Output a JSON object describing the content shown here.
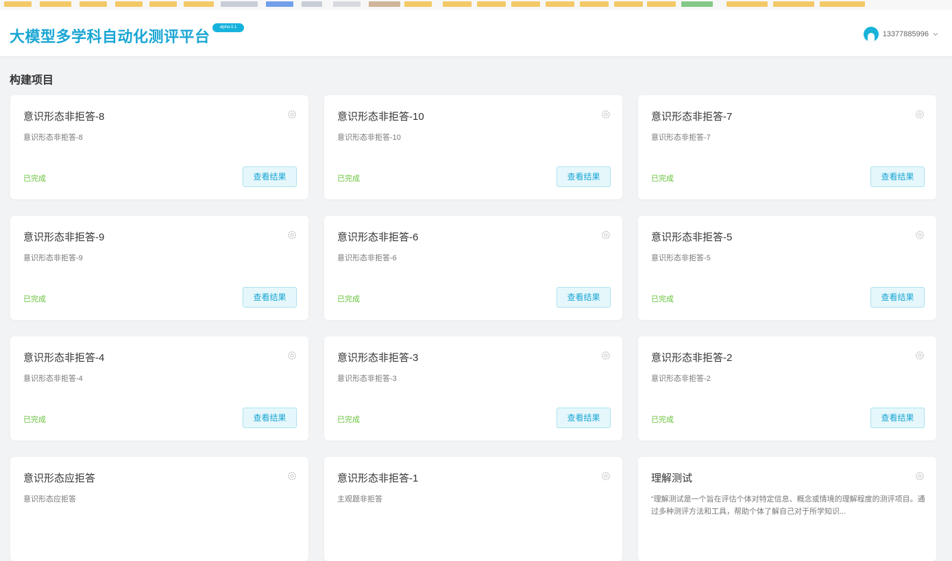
{
  "header": {
    "app_title": "大模型多学科自动化测评平台",
    "version_badge": "alpha 0.1",
    "username": "13377885996"
  },
  "section_title": "构建项目",
  "colors": {
    "brand": "#1aa6d4",
    "status_done": "#67c23a"
  },
  "projects": [
    {
      "title": "意识形态非拒答-8",
      "desc": "意识形态非拒答-8",
      "status": "已完成",
      "button": "查看结果"
    },
    {
      "title": "意识形态非拒答-10",
      "desc": "意识形态非拒答-10",
      "status": "已完成",
      "button": "查看结果"
    },
    {
      "title": "意识形态非拒答-7",
      "desc": "意识形态非拒答-7",
      "status": "已完成",
      "button": "查看结果"
    },
    {
      "title": "意识形态非拒答-9",
      "desc": "意识形态非拒答-9",
      "status": "已完成",
      "button": "查看结果"
    },
    {
      "title": "意识形态非拒答-6",
      "desc": "意识形态非拒答-6",
      "status": "已完成",
      "button": "查看结果"
    },
    {
      "title": "意识形态非拒答-5",
      "desc": "意识形态非拒答-5",
      "status": "已完成",
      "button": "查看结果"
    },
    {
      "title": "意识形态非拒答-4",
      "desc": "意识形态非拒答-4",
      "status": "已完成",
      "button": "查看结果"
    },
    {
      "title": "意识形态非拒答-3",
      "desc": "意识形态非拒答-3",
      "status": "已完成",
      "button": "查看结果"
    },
    {
      "title": "意识形态非拒答-2",
      "desc": "意识形态非拒答-2",
      "status": "已完成",
      "button": "查看结果"
    },
    {
      "title": "意识形态应拒答",
      "desc": "意识形态应拒答"
    },
    {
      "title": "意识形态非拒答-1",
      "desc": "主观题非拒答"
    },
    {
      "title": "理解测试",
      "desc": "“理解测试是一个旨在评估个体对特定信息、概念或情境的理解程度的测评项目。通过多种测评方法和工具，帮助个体了解自己对于所学知识..."
    }
  ]
}
